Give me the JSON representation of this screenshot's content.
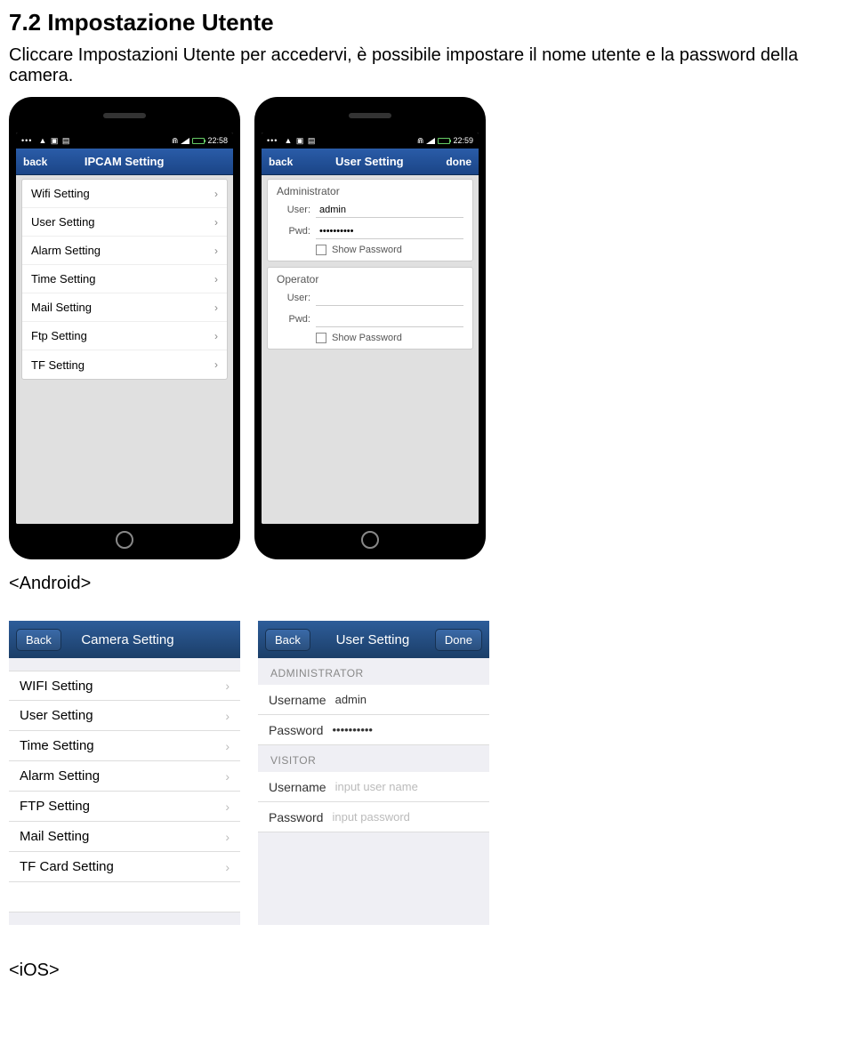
{
  "heading": "7.2   Impostazione Utente",
  "subtext": "Cliccare Impostazioni Utente per accedervi, è possibile impostare il nome utente e la password della camera.",
  "android_label": "<Android>",
  "ios_label": "<iOS>",
  "android": {
    "status": {
      "left_glyphs": "∙∙∙   👤  📷  🔋",
      "time_1": "22:58",
      "time_2": "22:59",
      "wifi": "📶"
    },
    "phone1": {
      "back": "back",
      "title": "IPCAM Setting",
      "items": [
        "Wifi Setting",
        "User Setting",
        "Alarm Setting",
        "Time Setting",
        "Mail Setting",
        "Ftp Setting",
        "TF Setting"
      ]
    },
    "phone2": {
      "back": "back",
      "title": "User Setting",
      "done": "done",
      "admin_section": "Administrator",
      "operator_section": "Operator",
      "user_label": "User:",
      "pwd_label": "Pwd:",
      "admin_user_value": "admin",
      "admin_pwd_value": "••••••••••",
      "show_password": "Show Password"
    }
  },
  "ios": {
    "panel1": {
      "back": "Back",
      "title": "Camera Setting",
      "items": [
        "WIFI Setting",
        "User Setting",
        "Time Setting",
        "Alarm Setting",
        "FTP Setting",
        "Mail Setting",
        "TF Card Setting"
      ]
    },
    "panel2": {
      "back": "Back",
      "title": "User Setting",
      "done": "Done",
      "admin_header": "ADMINISTRATOR",
      "visitor_header": "VISITOR",
      "username_label": "Username",
      "password_label": "Password",
      "admin_username_value": "admin",
      "admin_password_value": "••••••••••",
      "visitor_username_placeholder": "input user name",
      "visitor_password_placeholder": "input password"
    }
  }
}
